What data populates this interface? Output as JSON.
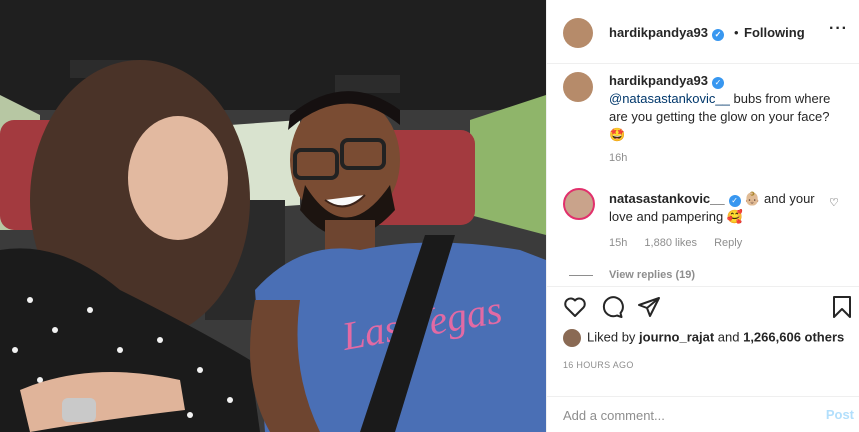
{
  "header": {
    "username": "hardikpandya93",
    "separator": "•",
    "follow_status": "Following",
    "more_icon": "more-horizontal-icon"
  },
  "caption": {
    "username": "hardikpandya93",
    "mention": "@natasastankovic__",
    "text": " bubs from where are you getting the glow on your face? 🤩",
    "time": "16h"
  },
  "comment": {
    "username": "natasastankovic__",
    "text": " 👶🏼 and your love and pampering 🥰",
    "time": "15h",
    "likes": "1,880 likes",
    "reply_label": "Reply",
    "view_replies": "View replies (19)"
  },
  "actions": {
    "icons": [
      "heart-icon",
      "comment-icon",
      "share-icon",
      "bookmark-icon"
    ]
  },
  "likes": {
    "prefix": "Liked by ",
    "user": "journo_rajat",
    "middle": " and ",
    "count": "1,266,606 others"
  },
  "timestamp": "16 HOURS AGO",
  "add_comment": {
    "placeholder": "Add a comment...",
    "post_label": "Post"
  },
  "colors": {
    "link_blue": "#00376b",
    "verified_blue": "#3897f0",
    "post_disabled": "#b2dffc",
    "muted": "#8e8e8e"
  }
}
